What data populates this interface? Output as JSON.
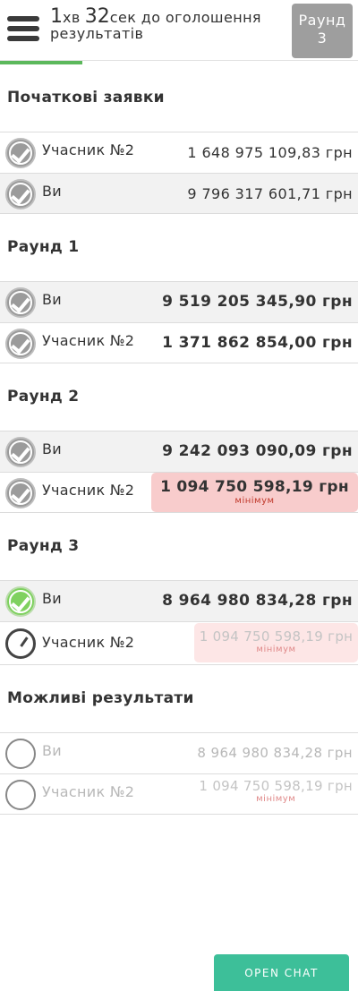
{
  "header": {
    "timer_min": "1",
    "timer_min_unit": "хв",
    "timer_sec": "32",
    "timer_sec_unit": "сек до оголошення",
    "timer_line2": "результатів",
    "round_label": "Раунд",
    "round_number": "3",
    "progress_fraction": 0.23
  },
  "sections": {
    "initial": {
      "title": "Початкові заявки",
      "rows": [
        {
          "name": "Учасник №2",
          "amount": "1 648 975 109,83 грн"
        },
        {
          "name": "Ви",
          "amount": "9 796 317 601,71 грн"
        }
      ]
    },
    "round1": {
      "title": "Раунд 1",
      "rows": [
        {
          "name": "Ви",
          "amount": "9 519 205 345,90 грн"
        },
        {
          "name": "Учасник №2",
          "amount": "1 371 862 854,00 грн"
        }
      ]
    },
    "round2": {
      "title": "Раунд 2",
      "rows": [
        {
          "name": "Ви",
          "amount": "9 242 093 090,09 грн"
        },
        {
          "name": "Учасник №2",
          "amount": "1 094 750 598,19 грн",
          "tag": "мінімум"
        }
      ]
    },
    "round3": {
      "title": "Раунд 3",
      "rows": [
        {
          "name": "Ви",
          "amount": "8 964 980 834,28 грн"
        },
        {
          "name": "Учасник №2",
          "amount": "1 094 750 598,19 грн",
          "tag": "мінімум"
        }
      ]
    },
    "results": {
      "title": "Можливі результати",
      "rows": [
        {
          "name": "Ви",
          "amount": "8 964 980 834,28 грн"
        },
        {
          "name": "Учасник №2",
          "amount": "1 094 750 598,19 грн",
          "tag": "мінімум"
        }
      ]
    }
  },
  "chat_button": "OPEN CHAT",
  "colors": {
    "progress": "#5cb85c",
    "round_badge": "#9e9e9e",
    "minimum_highlight": "#f8cccc",
    "chat_button": "#3dbf99",
    "active_check": "#7fd15f"
  },
  "icons": [
    "menu-icon",
    "check-icon",
    "check-active-icon",
    "clock-icon",
    "empty-circle-icon"
  ]
}
